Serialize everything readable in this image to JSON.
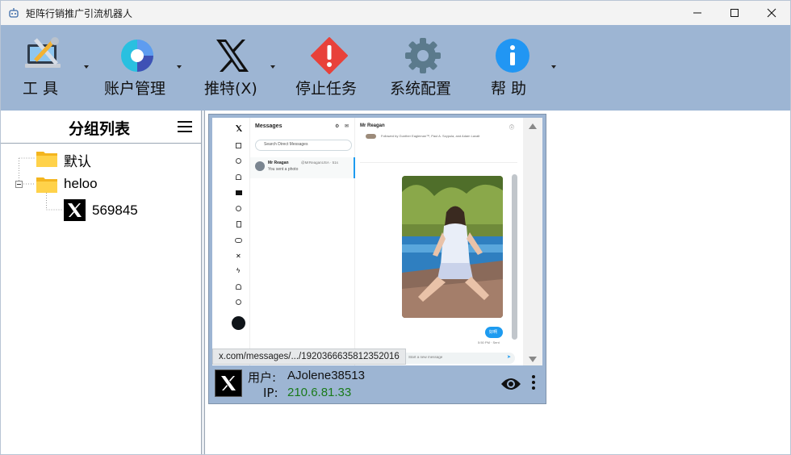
{
  "window": {
    "title": "矩阵行销推广引流机器人",
    "controls": {
      "minimize": "minimize",
      "maximize": "maximize",
      "close": "close"
    }
  },
  "toolbar": {
    "items": [
      {
        "label": "工 具",
        "icon": "tools-icon",
        "has_dropdown": true
      },
      {
        "label": "账户管理",
        "icon": "account-icon",
        "has_dropdown": true
      },
      {
        "label": "推特(X)",
        "icon": "x-logo-icon",
        "has_dropdown": true
      },
      {
        "label": "停止任务",
        "icon": "stop-icon",
        "has_dropdown": false
      },
      {
        "label": "系统配置",
        "icon": "gear-icon",
        "has_dropdown": false
      },
      {
        "label": "帮 助",
        "icon": "info-icon",
        "has_dropdown": true
      }
    ]
  },
  "group_panel": {
    "title": "分组列表",
    "tree": [
      {
        "label": "默认",
        "type": "folder"
      },
      {
        "label": "heloo",
        "type": "folder",
        "expanded": true,
        "children": [
          {
            "label": "569845",
            "type": "x-account"
          }
        ]
      }
    ]
  },
  "account_card": {
    "url_tooltip": "x.com/messages/.../1920366635812352016",
    "user_label": "用户:",
    "user_value": "AJolene38513",
    "ip_label": "IP:",
    "ip_value": "210.6.81.33",
    "preview": {
      "messages_header": "Messages",
      "search_placeholder": "Search Direct Messages",
      "conversation_name": "Mr Reagan",
      "conversation_handle": "@MrReaganUSA · 51s",
      "conversation_preview": "You sent a photo",
      "chat_title": "Mr Reagan",
      "followed_by": "Followed by Gunther Eagleman™, Paul A. Szypula, and Adam Laxalt",
      "sent_bubble": "好啊",
      "sent_time": "5:50 PM · Sent",
      "compose_placeholder": "Start a new message"
    }
  },
  "colors": {
    "toolbar_bg": "#9db5d3",
    "card_bg": "#9db5d3",
    "ip_value": "#1a7a1a",
    "stop_red": "#e8413a",
    "info_blue": "#2196f3",
    "gear_gray": "#5b7a8c"
  }
}
